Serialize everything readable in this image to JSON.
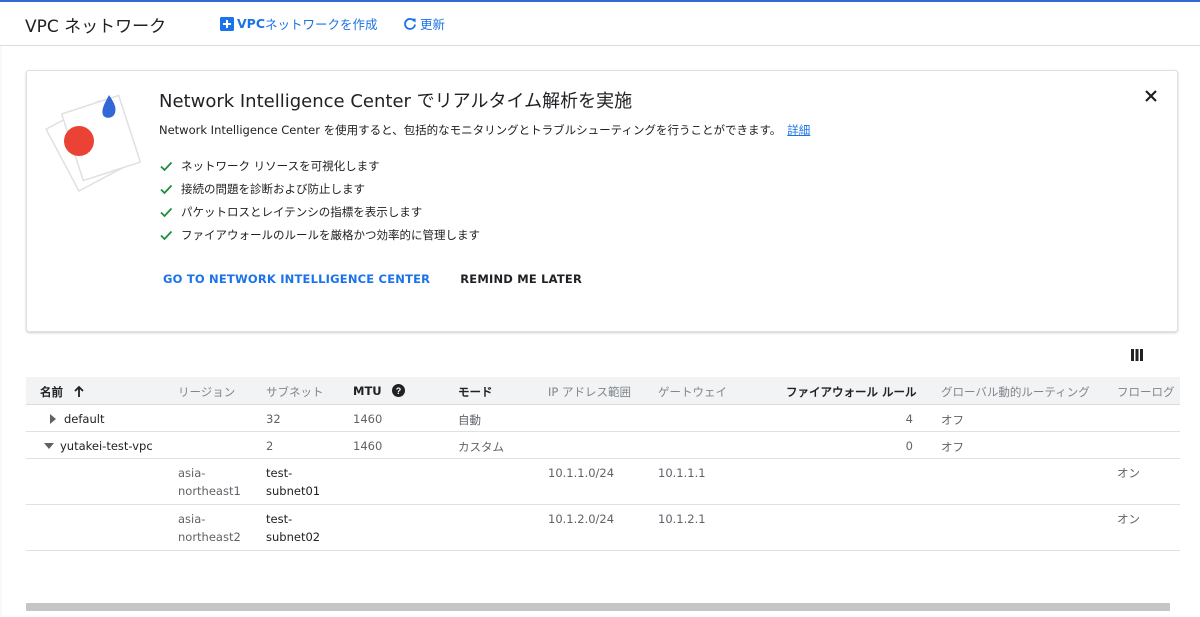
{
  "header": {
    "title": "VPC ネットワーク",
    "create_label_vpc": "VPC",
    "create_label_rest": " ネットワークを作成",
    "refresh_label": "更新"
  },
  "promo": {
    "title": "Network Intelligence Center でリアルタイム解析を実施",
    "description": "Network Intelligence Center を使用すると、包括的なモニタリングとトラブルシューティングを行うことができます。",
    "details_link": "詳細",
    "features": [
      "ネットワーク リソースを可視化します",
      "接続の問題を診断および防止します",
      "パケットロスとレイテンシの指標を表示します",
      "ファイアウォールのルールを厳格かつ効率的に管理します"
    ],
    "primary_action": "GO TO NETWORK INTELLIGENCE CENTER",
    "secondary_action": "REMIND ME LATER"
  },
  "table": {
    "columns": {
      "name": "名前",
      "region": "リージョン",
      "subnet": "サブネット",
      "mtu": "MTU",
      "mode": "モード",
      "ip_range": "IP アドレス範囲",
      "gateway": "ゲートウェイ",
      "firewall": "ファイアウォール ルール",
      "global_routing": "グローバル動的ルーティング",
      "flow_log": "フローログ"
    },
    "networks": [
      {
        "name": "default",
        "subnets": "32",
        "mtu": "1460",
        "mode": "自動",
        "firewall": "4",
        "global_routing": "オフ"
      },
      {
        "name": "yutakei-test-vpc",
        "subnets": "2",
        "mtu": "1460",
        "mode": "カスタム",
        "firewall": "0",
        "global_routing": "オフ"
      }
    ],
    "subnets": [
      {
        "region": "asia-northeast1",
        "name": "test-subnet01",
        "ip_range": "10.1.1.0/24",
        "gateway": "10.1.1.1",
        "flow_log": "オン"
      },
      {
        "region": "asia-northeast2",
        "name": "test-subnet02",
        "ip_range": "10.1.2.0/24",
        "gateway": "10.1.2.1",
        "flow_log": "オン"
      }
    ]
  },
  "colors": {
    "accent": "#1a73e8",
    "check": "#1e8e3e",
    "art_red": "#ea4335",
    "art_blue": "#4285f4"
  }
}
